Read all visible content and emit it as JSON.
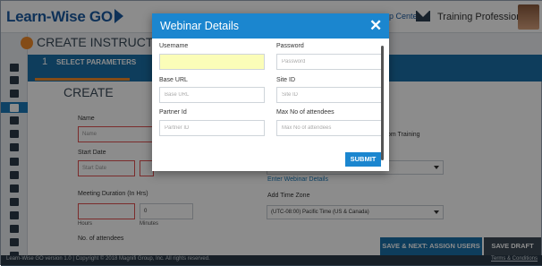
{
  "app": {
    "logo": "Learn-Wise GO",
    "help_center": "p Center",
    "user_name": "Training Professional",
    "page_title": "CREATE INSTRUCTOR LE",
    "step_number": "1",
    "step_label": "SELECT PARAMETERS",
    "section_title": "CREATE"
  },
  "form": {
    "name_label": "Name",
    "name_placeholder": "Name",
    "start_date_label": "Start Date",
    "start_date_placeholder": "Start Date",
    "meeting_duration_label": "Meeting Duration (In Hrs)",
    "hours_label": "Hours",
    "minutes_label": "Minutes",
    "minutes_value": "0",
    "attendees_label": "No. of attendees",
    "room_training": "om Training",
    "enter_webinar_link": "Enter Webinar Details",
    "time_zone_label": "Add Time Zone",
    "time_zone_value": "(UTC-08:00) Pacific Time (US & Canada)"
  },
  "footer": {
    "copyright": "Learn-Wise GO version 1.0 | Copyright © 2018 Magnifi Group, Inc. All rights reserved.",
    "terms": "Terms & Conditions",
    "save_next": "SAVE & NEXT: ASSIGN USERS",
    "save_draft": "SAVE DRAFT"
  },
  "modal": {
    "title": "Webinar Details",
    "close": "✕",
    "username_label": "Username",
    "username_value": "",
    "password_label": "Password",
    "password_placeholder": "Password",
    "base_url_label": "Base URL",
    "base_url_placeholder": "Base URL",
    "site_id_label": "Site ID",
    "site_id_placeholder": "Site ID",
    "partner_id_label": "Partner Id",
    "partner_id_placeholder": "Partner ID",
    "max_attendees_label": "Max No of attendees",
    "max_attendees_placeholder": "Max No of attendees",
    "submit": "SUBMIT"
  },
  "colors": {
    "primary": "#1b86cf",
    "accent": "#f08a2a",
    "highlight": "#fbfdb8"
  }
}
